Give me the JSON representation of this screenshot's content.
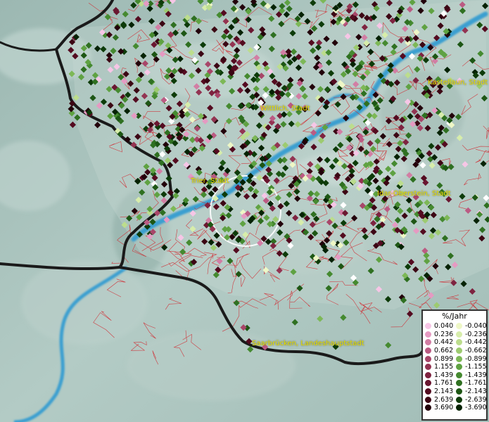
{
  "map": {
    "cities": [
      {
        "id": "wittlich",
        "name": "Wittlich, Stadt"
      },
      {
        "id": "trier",
        "name": "Trier, Stadt"
      },
      {
        "id": "kastellaun",
        "name": "Kastellaun, Stadt"
      },
      {
        "id": "idar",
        "name": "Idar-Oberstein, Stadt"
      },
      {
        "id": "saarbruecken",
        "name": "Saarbrücken, Landeshauptstadt"
      }
    ],
    "colors": {
      "terrain": "#a9c3bd",
      "river": "#3a9fd0",
      "borders_local": "#d2232a",
      "borders_national": "#1a1a1a",
      "selection_circle": "#ffffff"
    }
  },
  "legend": {
    "title": "%/Jahr",
    "positive": [
      {
        "value": "0.040",
        "color": "#f6c6e6"
      },
      {
        "value": "0.236",
        "color": "#e59ac2"
      },
      {
        "value": "0.442",
        "color": "#d27ea4"
      },
      {
        "value": "0.662",
        "color": "#bb5b83"
      },
      {
        "value": "0.899",
        "color": "#a84669"
      },
      {
        "value": "1.155",
        "color": "#933452"
      },
      {
        "value": "1.439",
        "color": "#7e2340"
      },
      {
        "value": "1.761",
        "color": "#6a1630"
      },
      {
        "value": "2.143",
        "color": "#540b20"
      },
      {
        "value": "2.639",
        "color": "#3c0514"
      },
      {
        "value": "3.690",
        "color": "#22010a"
      }
    ],
    "negative": [
      {
        "value": "-0.040",
        "color": "#eef7c6"
      },
      {
        "value": "-0.236",
        "color": "#d7edab"
      },
      {
        "value": "-0.442",
        "color": "#bcdd8d"
      },
      {
        "value": "-0.662",
        "color": "#9dcb70"
      },
      {
        "value": "-0.899",
        "color": "#7db857"
      },
      {
        "value": "-1.155",
        "color": "#5fa242"
      },
      {
        "value": "-1.439",
        "color": "#458a30"
      },
      {
        "value": "-1.761",
        "color": "#2f7021"
      },
      {
        "value": "-2.143",
        "color": "#1d5614"
      },
      {
        "value": "-2.639",
        "color": "#0d3b09"
      },
      {
        "value": "-3.690",
        "color": "#052203"
      }
    ]
  }
}
